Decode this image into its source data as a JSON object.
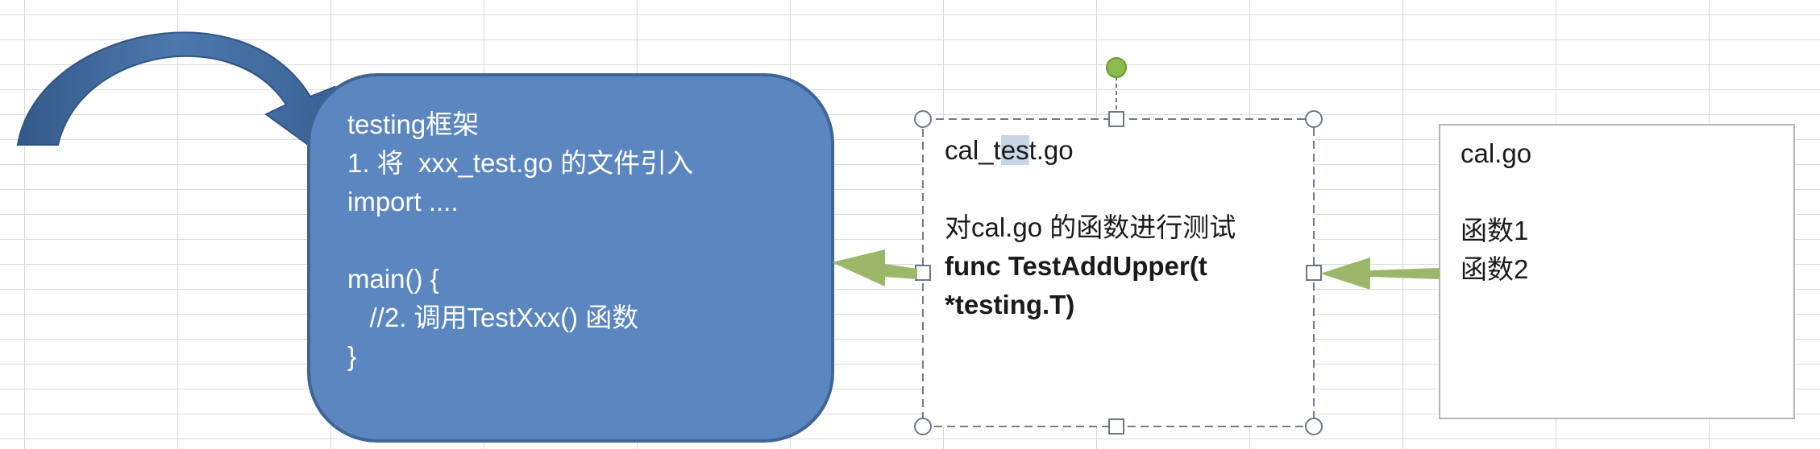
{
  "blue_box": {
    "lines": [
      "testing框架",
      "1. 将  xxx_test.go 的文件引入",
      "import ....",
      "",
      "main() {",
      "   //2. 调用TestXxx() 函数",
      "}"
    ]
  },
  "selected_box": {
    "filename": {
      "before": "cal_t",
      "highlight": "es",
      "after": "t.go"
    },
    "description": "对cal.go 的函数进行测试",
    "func_line1": "func TestAddUpper(t",
    "func_line2": "*testing.T)"
  },
  "source_box": {
    "filename": "cal.go",
    "lines": [
      "函数1",
      "函数2"
    ]
  },
  "colors": {
    "blue_box_fill": "#5b86bf",
    "blue_box_stroke": "#3e6594",
    "curved_arrow": "#3f6798",
    "green_arrow": "#9bb86a",
    "rotation_handle": "#8dbb4e"
  }
}
